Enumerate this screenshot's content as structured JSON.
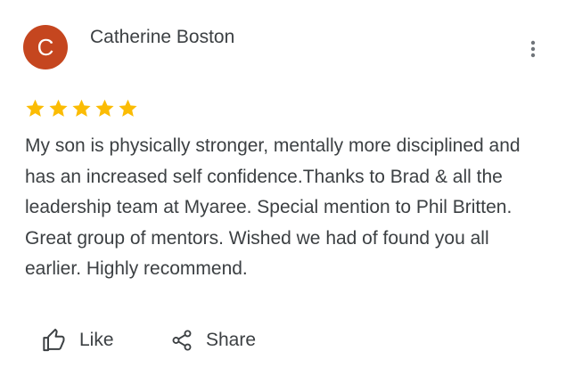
{
  "review": {
    "avatar_letter": "C",
    "avatar_color": "#c5461f",
    "author_name": "Catherine Boston",
    "rating": 5,
    "star_color": "#fbbc04",
    "text": "My son is physically stronger, mentally more disciplined and has an increased self confidence.Thanks to Brad & all the leadership team at Myaree. Special mention to Phil Britten. Great group of mentors. Wished we had of found you all earlier. Highly recommend.",
    "menu_icon": "more-vert-icon"
  },
  "actions": {
    "like": {
      "label": "Like",
      "icon": "thumbs-up-icon"
    },
    "share": {
      "label": "Share",
      "icon": "share-icon"
    }
  }
}
